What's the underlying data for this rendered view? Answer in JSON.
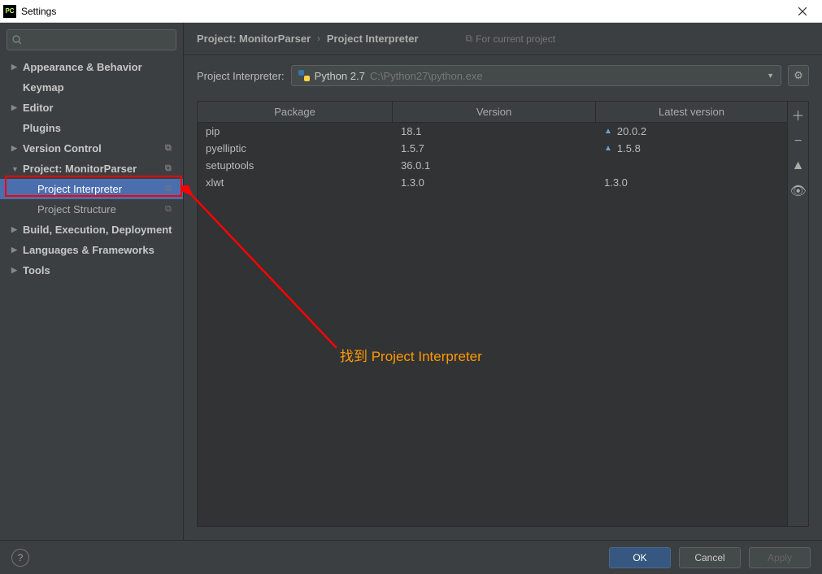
{
  "window": {
    "title": "Settings",
    "logo_text": "PC"
  },
  "search": {
    "placeholder": ""
  },
  "tree": {
    "items": [
      {
        "label": "Appearance & Behavior",
        "arrow": "right",
        "bold": true,
        "indent": 0,
        "badge": false
      },
      {
        "label": "Keymap",
        "arrow": "none",
        "bold": true,
        "indent": 0,
        "badge": false
      },
      {
        "label": "Editor",
        "arrow": "right",
        "bold": true,
        "indent": 0,
        "badge": false
      },
      {
        "label": "Plugins",
        "arrow": "none",
        "bold": true,
        "indent": 0,
        "badge": false
      },
      {
        "label": "Version Control",
        "arrow": "right",
        "bold": true,
        "indent": 0,
        "badge": true
      },
      {
        "label": "Project: MonitorParser",
        "arrow": "down",
        "bold": true,
        "indent": 0,
        "badge": true
      },
      {
        "label": "Project Interpreter",
        "arrow": "none",
        "bold": false,
        "indent": 1,
        "badge": true,
        "selected": true
      },
      {
        "label": "Project Structure",
        "arrow": "none",
        "bold": false,
        "indent": 1,
        "badge": true
      },
      {
        "label": "Build, Execution, Deployment",
        "arrow": "right",
        "bold": true,
        "indent": 0,
        "badge": false
      },
      {
        "label": "Languages & Frameworks",
        "arrow": "right",
        "bold": true,
        "indent": 0,
        "badge": false
      },
      {
        "label": "Tools",
        "arrow": "right",
        "bold": true,
        "indent": 0,
        "badge": false
      }
    ]
  },
  "breadcrumb": {
    "crumb1": "Project: MonitorParser",
    "crumb2": "Project Interpreter",
    "hint": "For current project"
  },
  "interpreter": {
    "label": "Project Interpreter:",
    "name": "Python 2.7",
    "path": "C:\\Python27\\python.exe"
  },
  "table": {
    "headers": {
      "pkg": "Package",
      "ver": "Version",
      "lat": "Latest version"
    },
    "rows": [
      {
        "pkg": "pip",
        "ver": "18.1",
        "lat": "20.0.2",
        "up": true
      },
      {
        "pkg": "pyelliptic",
        "ver": "1.5.7",
        "lat": "1.5.8",
        "up": true
      },
      {
        "pkg": "setuptools",
        "ver": "36.0.1",
        "lat": "",
        "up": false
      },
      {
        "pkg": "xlwt",
        "ver": "1.3.0",
        "lat": "1.3.0",
        "up": false
      }
    ]
  },
  "buttons": {
    "ok": "OK",
    "cancel": "Cancel",
    "apply": "Apply"
  },
  "annotation": {
    "text": "找到 Project Interpreter"
  }
}
